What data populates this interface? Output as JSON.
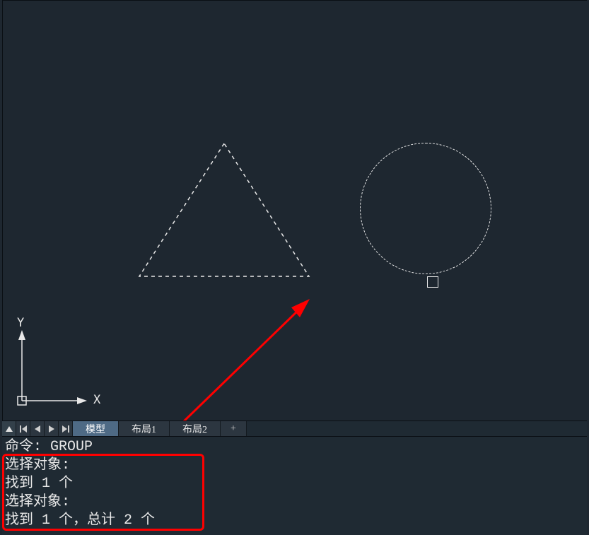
{
  "ucs": {
    "x_label": "X",
    "y_label": "Y"
  },
  "tabs": {
    "model": "模型",
    "layout1": "布局1",
    "layout2": "布局2",
    "add": "+"
  },
  "command_log": {
    "l1": "命令: GROUP",
    "l2": "选择对象:",
    "l3": "找到 1 个",
    "l4": "选择对象:",
    "l5": "找到 1 个，总计 2 个"
  }
}
